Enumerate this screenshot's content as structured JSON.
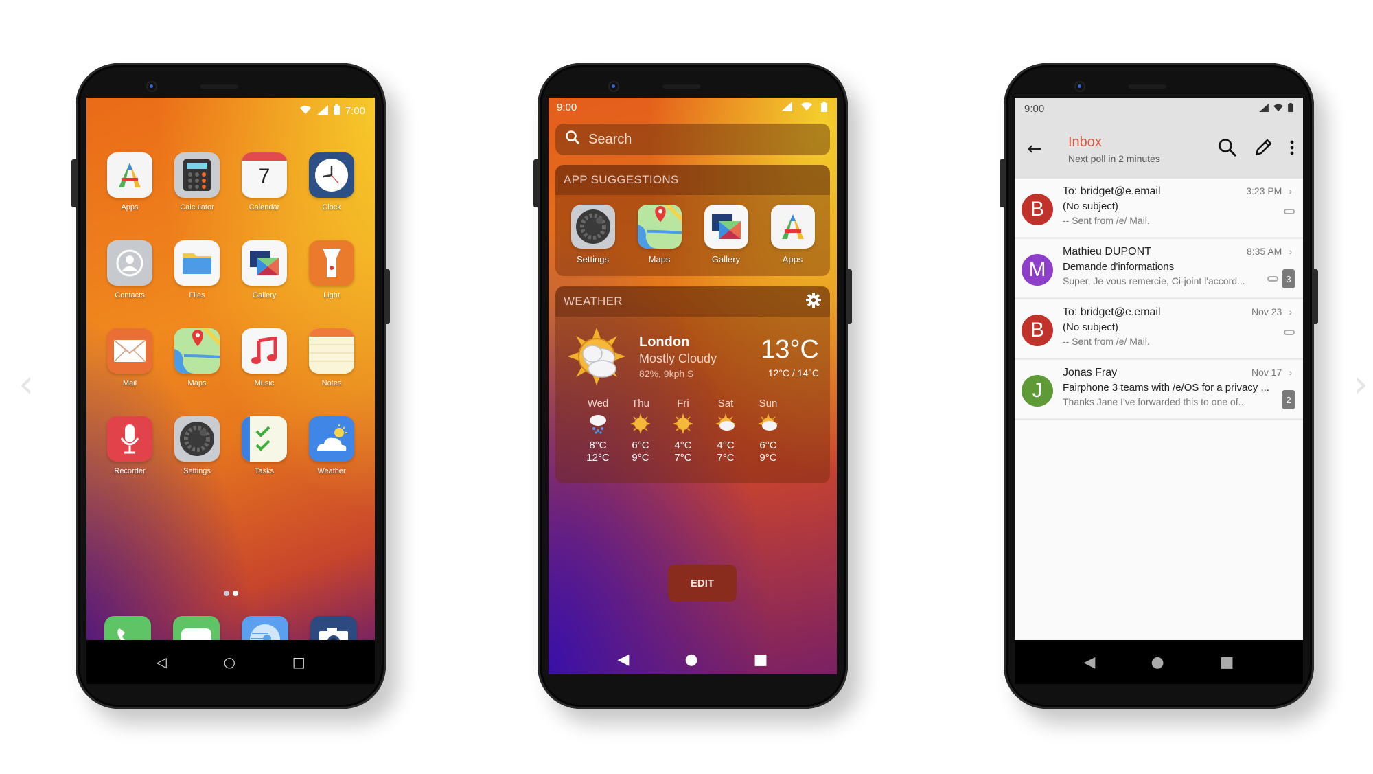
{
  "carousel": {
    "prev_icon": "‹",
    "next_icon": "›"
  },
  "home": {
    "status": {
      "time": "7:00",
      "network": "LTE"
    },
    "apps": [
      {
        "label": "Apps",
        "icon": "apps-icon",
        "bg": "#f5f5f5"
      },
      {
        "label": "Calculator",
        "icon": "calculator-icon",
        "bg": "#c9ccd1"
      },
      {
        "label": "Calendar",
        "icon": "calendar-icon",
        "bg": "#f7f7f7",
        "day": "7"
      },
      {
        "label": "Clock",
        "icon": "clock-icon",
        "bg": "#2c4f86"
      },
      {
        "label": "Contacts",
        "icon": "contacts-icon",
        "bg": "#c6c9cd"
      },
      {
        "label": "Files",
        "icon": "files-icon",
        "bg": "#f7f7f7"
      },
      {
        "label": "Gallery",
        "icon": "gallery-icon",
        "bg": "#f7f7f7"
      },
      {
        "label": "Light",
        "icon": "flashlight-icon",
        "bg": "#ea7a2c"
      },
      {
        "label": "Mail",
        "icon": "mail-icon",
        "bg": "#ea6f34"
      },
      {
        "label": "Maps",
        "icon": "maps-icon",
        "bg": "#b8e6a0"
      },
      {
        "label": "Music",
        "icon": "music-icon",
        "bg": "#f7f7f7"
      },
      {
        "label": "Notes",
        "icon": "notes-icon",
        "bg": "#faf4d8"
      },
      {
        "label": "Recorder",
        "icon": "microphone-icon",
        "bg": "#e2434a"
      },
      {
        "label": "Settings",
        "icon": "settings-icon",
        "bg": "#c9ccd1"
      },
      {
        "label": "Tasks",
        "icon": "tasks-icon",
        "bg": "#f7f7e7"
      },
      {
        "label": "Weather",
        "icon": "weather-icon",
        "bg": "#3f86e6"
      }
    ],
    "page_count": 2,
    "active_page": 2,
    "dock": [
      {
        "label": "Phone",
        "icon": "phone-icon",
        "bg": "#5ec466"
      },
      {
        "label": "Messages",
        "icon": "messages-icon",
        "bg": "#5ec466"
      },
      {
        "label": "Browser",
        "icon": "browser-icon",
        "bg": "#5aa0ee"
      },
      {
        "label": "Camera",
        "icon": "camera-icon",
        "bg": "#2d4a80"
      }
    ],
    "nav": {
      "back": "◁",
      "home": "○",
      "recents": "□"
    }
  },
  "widgets": {
    "status": {
      "time": "9:00"
    },
    "search_placeholder": "Search",
    "suggestions_title": "APP SUGGESTIONS",
    "suggestions": [
      {
        "label": "Settings",
        "icon": "settings-icon",
        "bg": "#c9ccd1"
      },
      {
        "label": "Maps",
        "icon": "maps-icon",
        "bg": "#b8e6a0"
      },
      {
        "label": "Gallery",
        "icon": "gallery-icon",
        "bg": "#f7f7f7"
      },
      {
        "label": "Apps",
        "icon": "apps-icon",
        "bg": "#f5f5f5"
      }
    ],
    "weather_title": "WEATHER",
    "weather": {
      "city": "London",
      "condition": "Mostly Cloudy",
      "details": "82%, 9kph S",
      "temp_now": "13°C",
      "temp_range": "12°C / 14°C",
      "forecast": [
        {
          "day": "Wed",
          "icon": "rain-cloud",
          "low": "8°C",
          "high": "12°C"
        },
        {
          "day": "Thu",
          "icon": "sunny",
          "low": "6°C",
          "high": "9°C"
        },
        {
          "day": "Fri",
          "icon": "sunny",
          "low": "4°C",
          "high": "7°C"
        },
        {
          "day": "Sat",
          "icon": "partly-cloudy",
          "low": "4°C",
          "high": "7°C"
        },
        {
          "day": "Sun",
          "icon": "partly-cloudy",
          "low": "6°C",
          "high": "9°C"
        }
      ]
    },
    "edit_label": "EDIT",
    "nav": {
      "back": "◀",
      "home": "●",
      "recents": "■"
    }
  },
  "mail": {
    "status": {
      "time": "9:00"
    },
    "title": "Inbox",
    "subtitle": "Next poll in 2 minutes",
    "accent": "#d9573e",
    "messages": [
      {
        "initial": "B",
        "avatar_color": "#c0322a",
        "from": "To: bridget@e.email",
        "date": "3:23 PM",
        "subject": "(No subject)",
        "preview": "-- Sent from /e/ Mail.",
        "attachment": true,
        "count": ""
      },
      {
        "initial": "M",
        "avatar_color": "#8e3fc9",
        "from": "Mathieu DUPONT",
        "date": "8:35 AM",
        "subject": "Demande d'informations",
        "preview": "Super, Je vous remercie, Ci-joint l'accord...",
        "attachment": true,
        "count": "3"
      },
      {
        "initial": "B",
        "avatar_color": "#c0322a",
        "from": "To: bridget@e.email",
        "date": "Nov 23",
        "subject": "(No subject)",
        "preview": "-- Sent from /e/ Mail.",
        "attachment": true,
        "count": ""
      },
      {
        "initial": "J",
        "avatar_color": "#5e9a35",
        "from": "Jonas Fray",
        "date": "Nov 17",
        "subject": "Fairphone 3 teams with /e/OS for a privacy ...",
        "preview": "Thanks Jane     I've forwarded this to one of...",
        "attachment": false,
        "count": "2"
      }
    ],
    "nav": {
      "back": "◀",
      "home": "●",
      "recents": "■"
    }
  }
}
